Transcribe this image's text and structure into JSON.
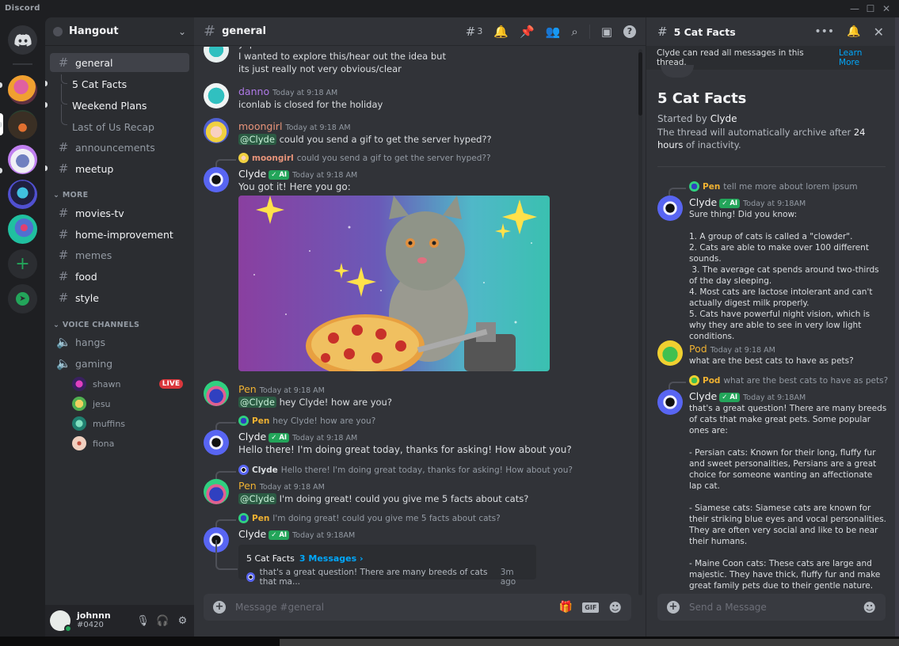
{
  "window": {
    "app_name": "Discord",
    "minimize": "—",
    "maximize": "☐",
    "close": "✕"
  },
  "servers": [
    {
      "name": "home",
      "icon": "discord-logo"
    },
    {
      "name": "server-1",
      "colors": [
        "#f0a030",
        "#c04080"
      ]
    },
    {
      "name": "server-2",
      "colors": [
        "#3a2f24",
        "#e07030"
      ]
    },
    {
      "name": "server-3",
      "colors": [
        "#c080f0",
        "#f08040"
      ]
    },
    {
      "name": "server-4",
      "colors": [
        "#5050d0",
        "#40c0e0"
      ]
    },
    {
      "name": "server-5",
      "colors": [
        "#20c0a0",
        "#e04070"
      ]
    },
    {
      "name": "add-server",
      "glyph": "+"
    },
    {
      "name": "explore",
      "glyph": "➤"
    }
  ],
  "guild": {
    "name": "Hangout",
    "channels": [
      {
        "name": "general",
        "type": "text-thread",
        "active": true
      },
      {
        "name": "5 Cat Facts",
        "type": "thread",
        "unread": true
      },
      {
        "name": "Weekend Plans",
        "type": "thread",
        "unread": true
      },
      {
        "name": "Last of Us Recap",
        "type": "thread",
        "unread": false
      },
      {
        "name": "announcements",
        "type": "text",
        "unread": false
      },
      {
        "name": "meetup",
        "type": "text",
        "unread": true
      }
    ],
    "categories": [
      {
        "name": "MORE",
        "channels": [
          {
            "name": "movies-tv",
            "unread": true
          },
          {
            "name": "home-improvement",
            "unread": true
          },
          {
            "name": "memes",
            "unread": false
          },
          {
            "name": "food",
            "unread": true
          },
          {
            "name": "style",
            "unread": true
          }
        ]
      },
      {
        "name": "VOICE CHANNELS",
        "channels": [
          {
            "name": "hangs"
          },
          {
            "name": "gaming",
            "users": [
              {
                "name": "shawn",
                "live": "LIVE",
                "color": "#7040a0"
              },
              {
                "name": "jesu",
                "color": "#e0c040"
              },
              {
                "name": "muffins",
                "color": "#30a090"
              },
              {
                "name": "fiona",
                "color": "#f0d0c0"
              }
            ]
          }
        ]
      }
    ]
  },
  "user": {
    "name": "johnnn",
    "tag": "#0420",
    "status": "online"
  },
  "channel_header": {
    "name": "general",
    "threads_count": "3"
  },
  "messages": [
    {
      "partial_top": "yep.",
      "lines": [
        "I wanted to explore this/hear out the idea but",
        "its just really not very obvious/clear"
      ]
    },
    {
      "author": "danno",
      "color": "#b07ae8",
      "time": "Today at 9:18 AM",
      "text": "iconlab is closed for the holiday"
    },
    {
      "author": "moongirl",
      "color": "#e8947a",
      "time": "Today at 9:18 AM",
      "mention": "@Clyde",
      "text": "could you send a gif to get the server hyped??"
    },
    {
      "reply_to": {
        "author": "moongirl",
        "color": "#e8947a",
        "text": "could you send a gif to get the server hyped??"
      },
      "author": "Clyde",
      "badge": "✓ AI",
      "time": "Today at 9:18 AM",
      "text": "You got it! Here you go:",
      "attachment": "cat-dj-pizza-space-gif"
    },
    {
      "author": "Pen",
      "color": "#f0b232",
      "time": "Today at 9:18 AM",
      "mention": "@Clyde",
      "text": "hey Clyde! how are you?"
    },
    {
      "reply_to": {
        "author": "Pen",
        "color": "#f0b232",
        "text": "hey Clyde! how are you?"
      },
      "author": "Clyde",
      "badge": "✓ AI",
      "time": "Today at 9:18 AM",
      "text": "Hello there! I'm doing great today, thanks for asking! How about you?"
    },
    {
      "reply_to": {
        "author": "Clyde",
        "color": "#dbdee1",
        "text": "Hello there! I'm doing great today, thanks for asking! How about you?"
      },
      "author": "Pen",
      "color": "#f0b232",
      "time": "Today at 9:18 AM",
      "mention": "@Clyde",
      "text": "I'm doing great! could you give me 5 facts about cats?"
    },
    {
      "reply_to": {
        "author": "Pen",
        "color": "#f0b232",
        "text": "I'm doing great! could you give me 5 facts about cats?"
      },
      "author": "Clyde",
      "badge": "✓ AI",
      "time": "Today at 9:18AM",
      "thread": {
        "title": "5 Cat Facts",
        "count": "3 Messages ›",
        "preview": "that's a great question! There are many breeds of cats that ma...",
        "ago": "3m ago"
      }
    }
  ],
  "composer": {
    "placeholder": "Message #general",
    "gif_label": "GIF"
  },
  "thread_panel": {
    "title": "5 Cat Facts",
    "notice": "Clyde can read all messages in this thread.",
    "notice_link": "Learn More",
    "heading": "5 Cat Facts",
    "started_by_label": "Started by",
    "started_by": "Clyde",
    "archive_prefix": "The thread will automatically archive after",
    "archive_duration": "24 hours",
    "archive_suffix": "of inactivity.",
    "messages": [
      {
        "reply_to": {
          "author": "Pen",
          "color": "#f0b232",
          "text": "tell me more about lorem ipsum"
        },
        "author": "Clyde",
        "badge": "✓ AI",
        "time": "Today at 9:18AM",
        "text": "Sure thing! Did you know:\n\n1. A group of cats is called a \"clowder\".\n2. Cats are able to make over 100 different sounds.\n 3. The average cat spends around two-thirds of the day sleeping.\n4. Most cats are lactose intolerant and can't actually digest milk properly.\n5. Cats have powerful night vision, which is why they are able to see in very low light conditions."
      },
      {
        "author": "Pod",
        "color": "#f0b232",
        "time": "Today at 9:18 AM",
        "text": "what are the best cats to have as pets?"
      },
      {
        "reply_to": {
          "author": "Pod",
          "color": "#f0b232",
          "text": "what are the best cats to have as pets?"
        },
        "author": "Clyde",
        "badge": "✓ AI",
        "time": "Today at 9:18AM",
        "text": "that's a great question! There are many breeds of cats that make great pets. Some popular ones are:\n\n- Persian cats: Known for their long, fluffy fur and sweet personalities, Persians are a great choice for someone wanting an affectionate lap cat.\n\n- Siamese cats: Siamese cats are known for their striking blue eyes and vocal personalities. They are often very social and like to be near their humans.\n\n- Maine Coon cats: These cats are large and majestic. They have thick, fluffy fur and make great family pets due to their gentle nature."
      }
    ],
    "composer_placeholder": "Send a Message"
  },
  "colors": {
    "accent": "#5865f2",
    "online": "#23a55a",
    "link": "#00a8fc",
    "live": "#da373c"
  }
}
